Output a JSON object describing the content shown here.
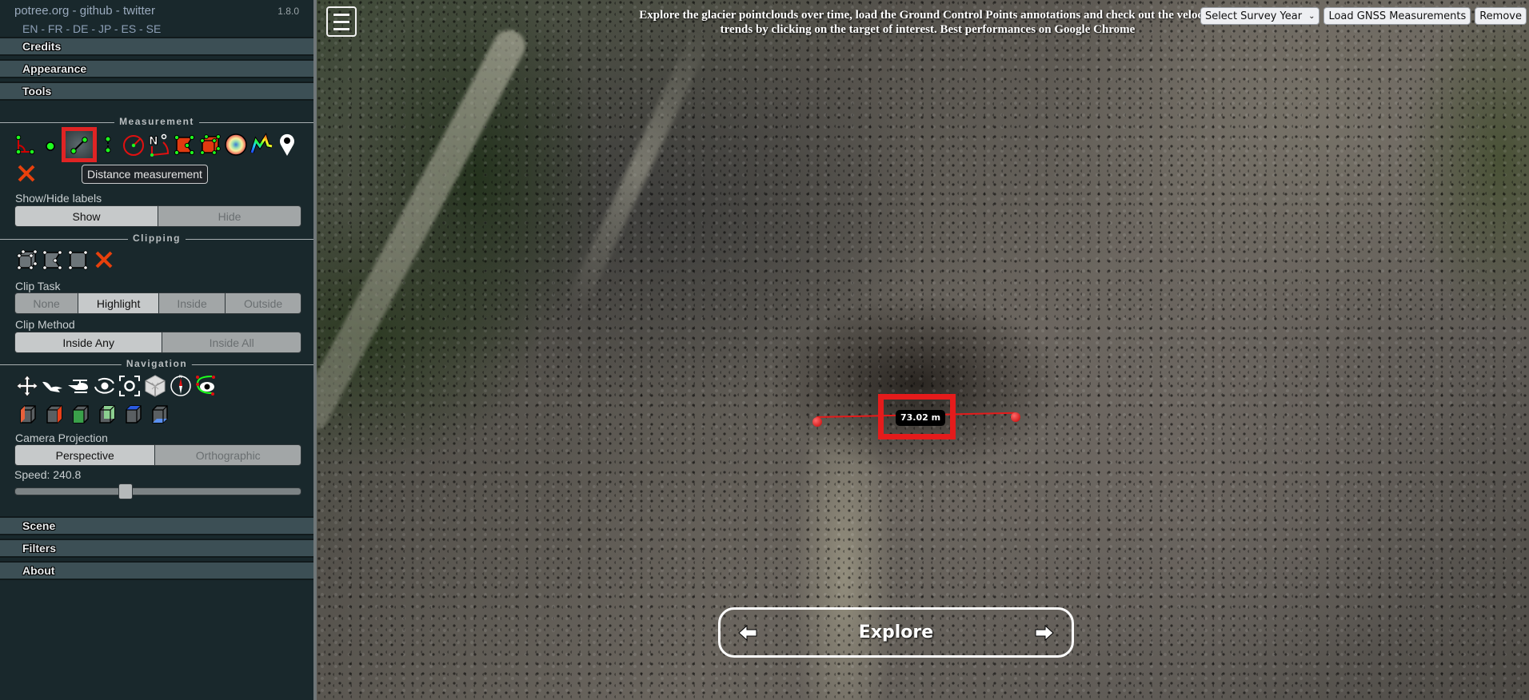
{
  "sidebar": {
    "header": {
      "links": [
        "potree.org",
        "github",
        "twitter"
      ],
      "link_separator": " - ",
      "version": "1.8.0",
      "languages": [
        "EN",
        "FR",
        "DE",
        "JP",
        "ES",
        "SE"
      ]
    },
    "sections_top": [
      "Credits",
      "Appearance",
      "Tools"
    ],
    "tools": {
      "measurement": {
        "title": "Measurement",
        "icons": [
          "angle-icon",
          "point-icon",
          "distance-icon",
          "height-icon",
          "circle-icon",
          "azimuth-icon",
          "area-icon",
          "volume-icon",
          "sphere-volume-icon",
          "height-profile-icon",
          "annotation-icon",
          "remove-measurements-icon"
        ],
        "selected": "distance-icon",
        "tooltip": "Distance measurement",
        "labels_title": "Show/Hide labels",
        "labels_options": [
          "Show",
          "Hide"
        ],
        "labels_selected": "Show"
      },
      "clipping": {
        "title": "Clipping",
        "icons": [
          "clip-volume-icon",
          "clip-polygon-icon",
          "clip-screen-box-icon",
          "remove-clipping-icon"
        ],
        "clip_task_title": "Clip Task",
        "clip_task_options": [
          "None",
          "Highlight",
          "Inside",
          "Outside"
        ],
        "clip_task_selected": "Highlight",
        "clip_method_title": "Clip Method",
        "clip_method_options": [
          "Inside Any",
          "Inside All"
        ],
        "clip_method_selected": "Inside Any"
      },
      "navigation": {
        "title": "Navigation",
        "icons": [
          "earth-controls-icon",
          "fly-controls-icon",
          "helicopter-controls-icon",
          "orbit-controls-icon",
          "full-extent-icon",
          "navigation-cube-icon",
          "compass-icon",
          "camera-animation-icon"
        ],
        "view_icons": [
          "left-view-icon",
          "right-view-icon",
          "front-view-icon",
          "back-view-icon",
          "top-view-icon",
          "bottom-view-icon"
        ],
        "projection_title": "Camera Projection",
        "projection_options": [
          "Perspective",
          "Orthographic"
        ],
        "projection_selected": "Perspective",
        "speed_label": "Speed: 240.8",
        "speed_fraction": 0.38
      }
    },
    "sections_bottom": [
      "Scene",
      "Filters",
      "About"
    ]
  },
  "viewport": {
    "banner": "Explore the glacier pointclouds over time, load the Ground Control Points annotations and check out the velocity trends by clicking on the target of interest. Best performances on Google Chrome",
    "survey_select": {
      "selected": "Select Survey Year"
    },
    "load_button": "Load GNSS Measurements",
    "remove_button": "Remove",
    "measurement_label": "73.02 m",
    "explore": {
      "title": "Explore"
    }
  },
  "colors": {
    "sidebar_bg": "#19282c",
    "accordion_bg": "#3c4f55",
    "measure_red": "#e51b1b",
    "highlight_green": "#1eff1e"
  }
}
